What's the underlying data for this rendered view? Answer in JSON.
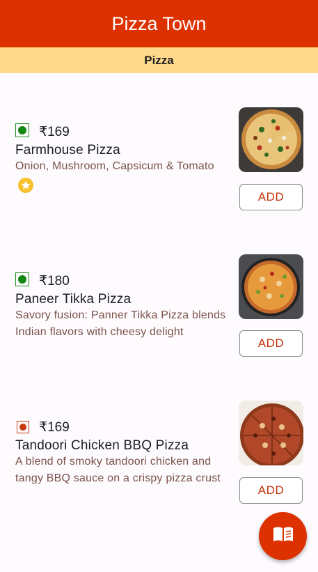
{
  "app": {
    "title": "Pizza Town"
  },
  "category": {
    "title": "Pizza"
  },
  "items": [
    {
      "price": "₹169",
      "name": "Farmhouse Pizza",
      "description": "Onion, Mushroom, Capsicum & Tomato",
      "veg": true,
      "bestseller_icon": "star-badge-icon",
      "add_label": "ADD"
    },
    {
      "price": "₹180",
      "name": "Paneer Tikka Pizza",
      "description": "Savory fusion: Panner Tikka Pizza blends Indian flavors with cheesy delight",
      "veg": true,
      "add_label": "ADD"
    },
    {
      "price": "₹169",
      "name": "Tandoori Chicken BBQ Pizza",
      "description": "A blend of smoky tandoori chicken and tangy BBQ sauce on a crispy pizza crust",
      "veg": false,
      "add_label": "ADD"
    }
  ],
  "fab": {
    "icon": "menu-book-icon"
  },
  "colors": {
    "primary": "#dd3100",
    "section_bar": "#ffd98b",
    "veg": "#108a10",
    "nonveg": "#c63b12",
    "description": "#7a5247"
  }
}
